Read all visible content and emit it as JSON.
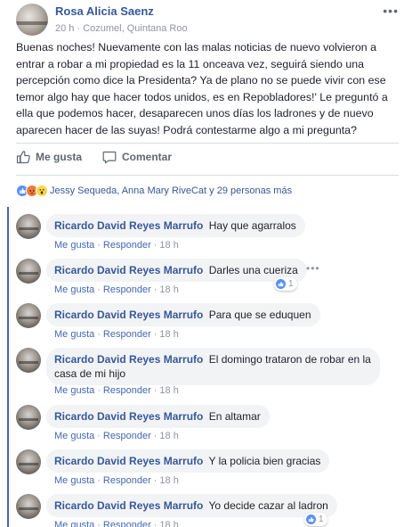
{
  "post": {
    "author": "Rosa Alicia Saenz",
    "time": "20 h",
    "location": "Cozumel, Quintana Roo",
    "text": "Buenas noches! Nuevamente con las malas noticias de nuevo volvieron a entrar a robar a mi propiedad es la 11 onceava vez, seguirá siendo una percepción como dice la Presidenta? Ya de plano no se puede vivir con ese temor algo hay que hacer todos unidos, es en Repobladores!' Le preguntó a ella que podemos hacer, desaparecen unos días los ladrones y de nuevo aparecen hacer de las suyas! Podrá contestarme algo a mi pregunta?"
  },
  "actions": {
    "like": "Me gusta",
    "comment": "Comentar"
  },
  "reactions": {
    "icons": [
      "like-icon",
      "angry-icon",
      "wow-icon"
    ],
    "text": "Jessy Sequeda, Anna Mary RiveCat y 29 personas más"
  },
  "comment_links": {
    "like": "Me gusta",
    "reply": "Responder",
    "separator": "·"
  },
  "comments": [
    {
      "author": "Ricardo David Reyes Marrufo",
      "text": "Hay que agarralos",
      "time": "18 h"
    },
    {
      "author": "Ricardo David Reyes Marrufo",
      "text": "Darles una cueriza",
      "time": "18 h",
      "likes": "1"
    },
    {
      "author": "Ricardo David Reyes Marrufo",
      "text": "Para que se eduquen",
      "time": "18 h"
    },
    {
      "author": "Ricardo David Reyes Marrufo",
      "text": "El domingo trataron de robar en la casa de mi hijo",
      "time": "18 h"
    },
    {
      "author": "Ricardo David Reyes Marrufo",
      "text": "En altamar",
      "time": "18 h"
    },
    {
      "author": "Ricardo David Reyes Marrufo",
      "text": "Y la policia bien gracias",
      "time": "18 h"
    },
    {
      "author": "Ricardo David Reyes Marrufo",
      "text": "Yo decide cazar al ladron",
      "time": "18 h",
      "likes": "1"
    }
  ],
  "colors": {
    "link": "#365899",
    "accent": "#4267b2",
    "muted": "#90949c",
    "bubble": "#f2f3f5"
  }
}
